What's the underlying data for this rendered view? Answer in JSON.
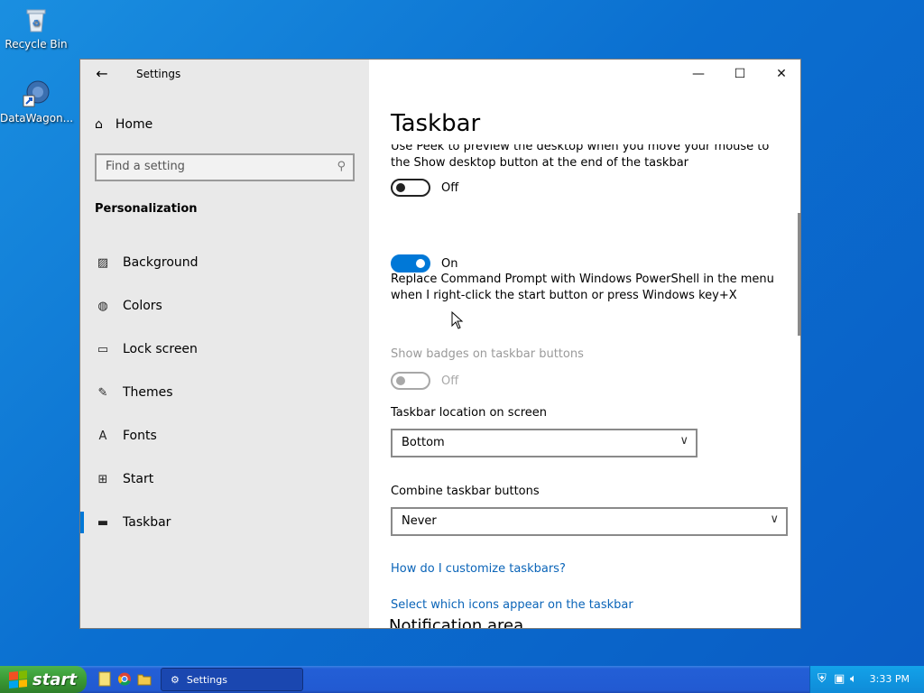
{
  "desktop": {
    "icons": [
      {
        "label": "Recycle Bin",
        "icon": "recycle-bin-icon"
      },
      {
        "label": "DataWagon...",
        "icon": "datawagon-icon"
      }
    ]
  },
  "window": {
    "title": "Settings",
    "back_icon": "back-arrow-icon",
    "caption": {
      "minimize": "—",
      "maximize": "☐",
      "close": "✕"
    }
  },
  "nav": {
    "home_label": "Home",
    "search_placeholder": "Find a setting",
    "section_title": "Personalization",
    "items": [
      {
        "label": "Background",
        "icon": "picture-icon"
      },
      {
        "label": "Colors",
        "icon": "palette-icon"
      },
      {
        "label": "Lock screen",
        "icon": "lock-screen-icon"
      },
      {
        "label": "Themes",
        "icon": "themes-icon"
      },
      {
        "label": "Fonts",
        "icon": "fonts-icon"
      },
      {
        "label": "Start",
        "icon": "start-icon"
      },
      {
        "label": "Taskbar",
        "icon": "taskbar-icon",
        "active": true
      }
    ]
  },
  "content": {
    "page_title": "Taskbar",
    "settings": [
      {
        "text": "Use Peek to preview the desktop when you move your mouse to the Show desktop button at the end of the taskbar",
        "state": "Off"
      },
      {
        "text": "Replace Command Prompt with Windows PowerShell in the menu when I right-click the start button or press Windows key+X",
        "state": "On"
      },
      {
        "text": "Show badges on taskbar buttons",
        "state": "Off"
      }
    ],
    "location": {
      "label": "Taskbar location on screen",
      "value": "Bottom"
    },
    "combine": {
      "label": "Combine taskbar buttons",
      "value": "Never"
    },
    "help_link": "How do I customize taskbars?",
    "notification_title": "Notification area",
    "notification_link": "Select which icons appear on the taskbar"
  },
  "taskbar": {
    "start_label": "start",
    "task_label": "Settings",
    "clock": "3:33 PM"
  },
  "colors": {
    "accent": "#0078d7",
    "link": "#0a64b8"
  }
}
